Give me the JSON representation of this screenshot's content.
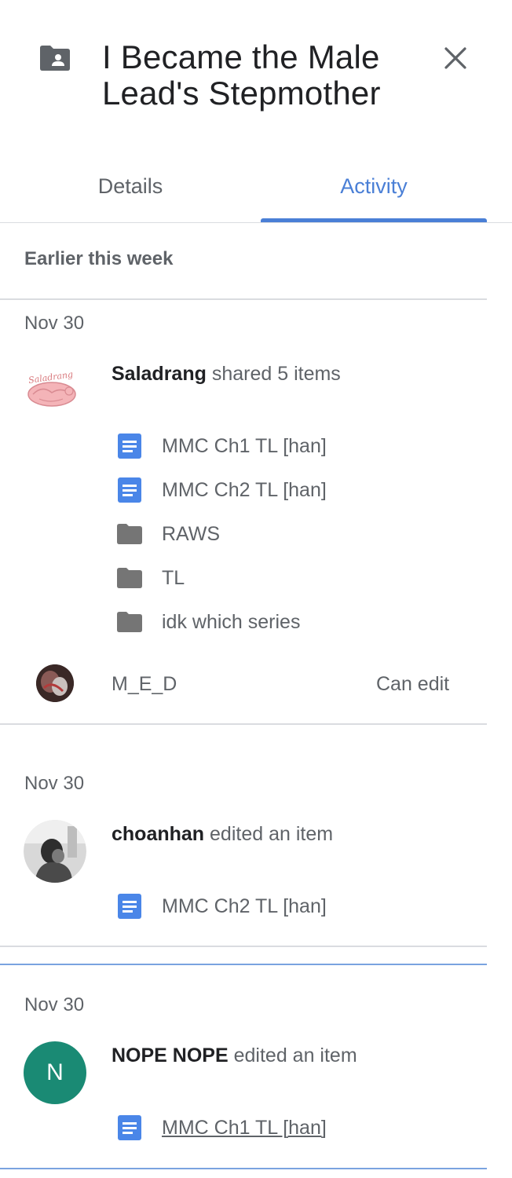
{
  "header": {
    "title": "I Became the Male Lead's Stepmother",
    "folder_icon": "shared-folder-icon",
    "close_icon": "close-icon"
  },
  "tabs": [
    {
      "label": "Details",
      "active": false
    },
    {
      "label": "Activity",
      "active": true
    }
  ],
  "section_label": "Earlier this week",
  "colors": {
    "accent": "#4a7fd6",
    "doc_icon": "#4a86e8",
    "folder_icon": "#757575",
    "letter_avatar_bg": "#1a8a74"
  },
  "activities": [
    {
      "date": "Nov 30",
      "user": "Saladrang",
      "action": "shared 5 items",
      "avatar_text": "Saladrang",
      "items": [
        {
          "type": "doc",
          "name": "MMC Ch1 TL [han]"
        },
        {
          "type": "doc",
          "name": "MMC Ch2 TL [han]"
        },
        {
          "type": "folder",
          "name": "RAWS"
        },
        {
          "type": "folder",
          "name": "TL"
        },
        {
          "type": "folder",
          "name": "idk which series"
        }
      ],
      "shared_with": {
        "name": "M_E_D",
        "permission": "Can edit"
      }
    },
    {
      "date": "Nov 30",
      "user": "choanhan",
      "action": "edited an item",
      "items": [
        {
          "type": "doc",
          "name": "MMC Ch2 TL [han]"
        }
      ]
    },
    {
      "date": "Nov 30",
      "user": "NOPE NOPE",
      "action": "edited an item",
      "avatar_letter": "N",
      "items": [
        {
          "type": "doc",
          "name": "MMC Ch1 TL [han]"
        }
      ]
    }
  ]
}
